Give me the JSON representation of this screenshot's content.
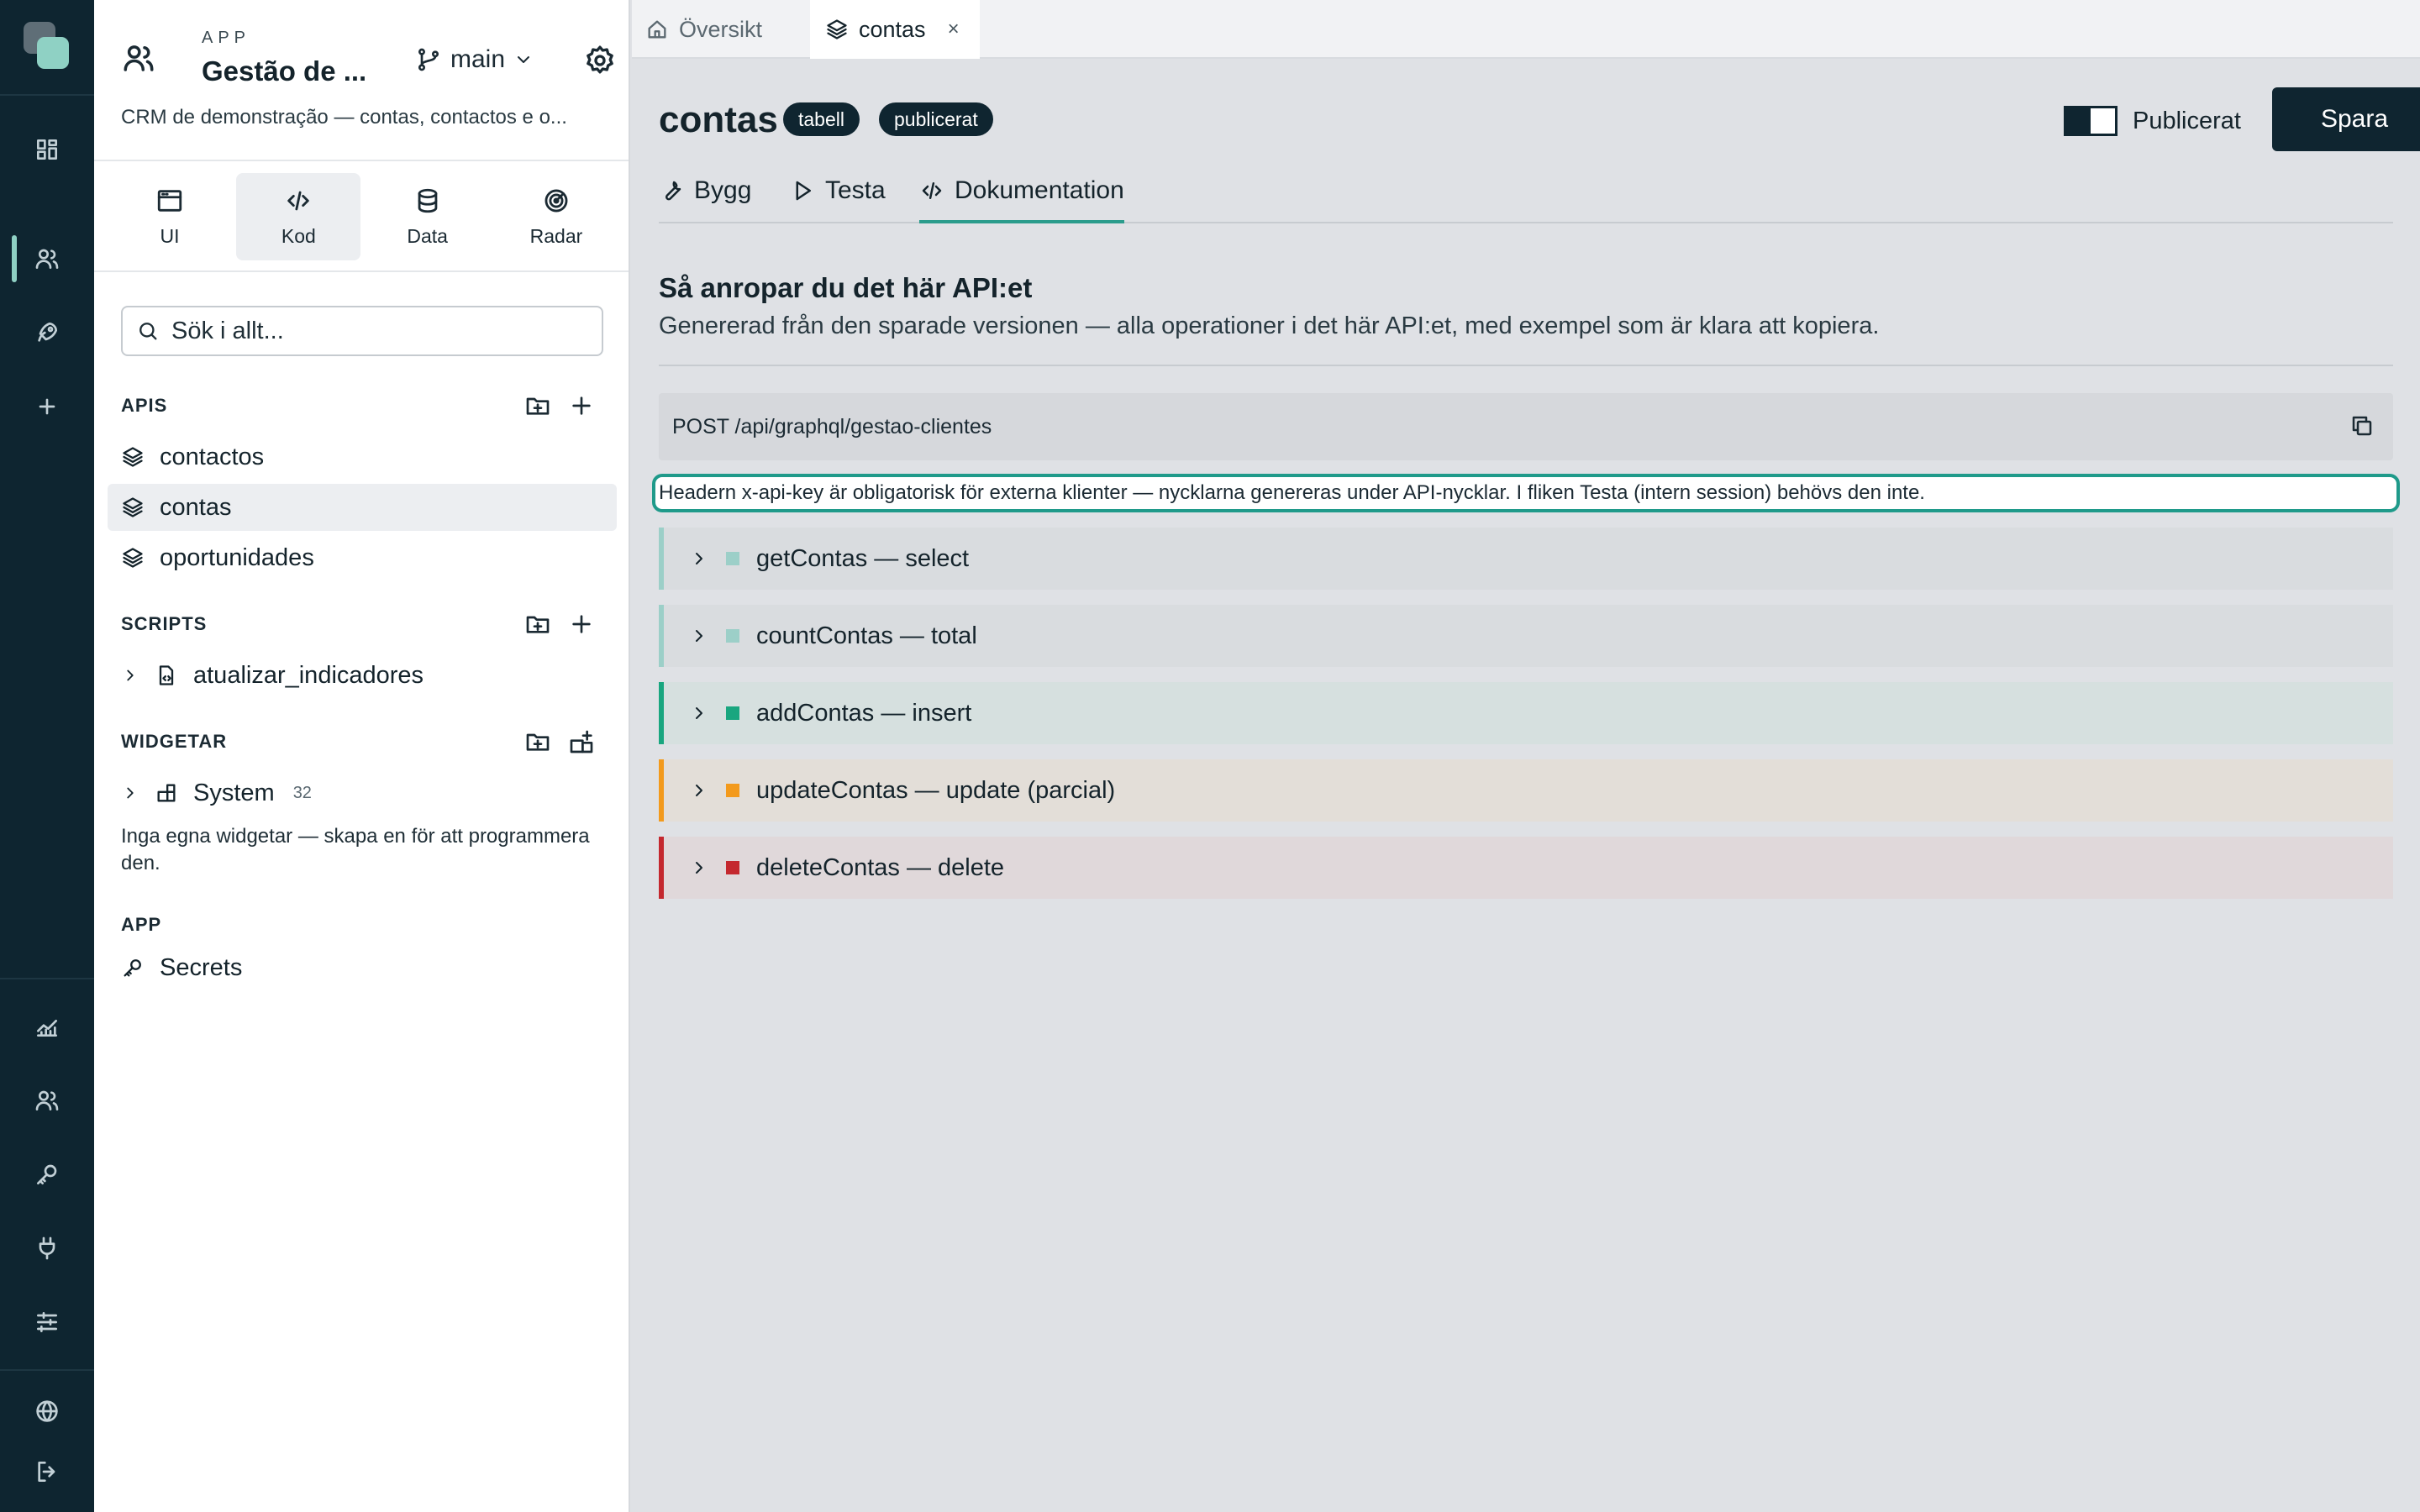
{
  "app": {
    "kicker": "APP",
    "title": "Gestão de ...",
    "branch": "main",
    "description": "CRM de demonstração — contas, contactos e o..."
  },
  "rail": {
    "icons": [
      "dashboard-icon",
      "users-icon",
      "rocket-icon",
      "plus-icon",
      "chart-icon",
      "team-icon",
      "key-icon",
      "plug-icon",
      "sliders-icon",
      "globe-icon",
      "logout-icon"
    ]
  },
  "modes": [
    {
      "label": "UI",
      "icon": "window-icon"
    },
    {
      "label": "Kod",
      "icon": "code-icon",
      "active": true
    },
    {
      "label": "Data",
      "icon": "database-icon"
    },
    {
      "label": "Radar",
      "icon": "radar-icon"
    }
  ],
  "search": {
    "placeholder": "Sök i allt..."
  },
  "sections": {
    "apis": {
      "title": "APIS",
      "items": [
        "contactos",
        "contas",
        "oportunidades"
      ],
      "active": "contas"
    },
    "scripts": {
      "title": "SCRIPTS",
      "items": [
        "atualizar_indicadores"
      ]
    },
    "widgets": {
      "title": "WIDGETAR",
      "system_label": "System",
      "system_count": "32",
      "empty": "Inga egna widgetar — skapa en för att programmera den."
    },
    "app": {
      "title": "APP",
      "items": [
        "Secrets"
      ]
    }
  },
  "tabs": [
    {
      "label": "Översikt",
      "icon": "home-icon"
    },
    {
      "label": "contas",
      "icon": "layers-icon",
      "active": true,
      "close": "×"
    }
  ],
  "page": {
    "title": "contas",
    "badges": [
      "tabell",
      "publicerat"
    ],
    "toggle_label": "Publicerat",
    "toggle_on": true,
    "save_label": "Spara",
    "subtabs": [
      {
        "label": "Bygg",
        "icon": "wrench-icon"
      },
      {
        "label": "Testa",
        "icon": "play-icon"
      },
      {
        "label": "Dokumentation",
        "icon": "code-icon",
        "active": true
      }
    ]
  },
  "docs": {
    "title": "Så anropar du det här API:et",
    "subtitle": "Genererad från den sparade versionen — alla operationer i det här API:et, med exempel som är klara att kopiera.",
    "endpoint": "POST /api/graphql/gestao-clientes",
    "hint": "Headern x-api-key är obligatorisk för externa klienter — nycklarna genereras under API-nycklar. I fliken Testa (intern session) behövs den inte.",
    "operations": [
      {
        "label": "getContas — select",
        "accent": "#9ccfc8",
        "square": "#9ccfc8",
        "bg": "#d9dcdf"
      },
      {
        "label": "countContas — total",
        "accent": "#9ccfc8",
        "square": "#9ccfc8",
        "bg": "#d9dcdf"
      },
      {
        "label": "addContas — insert",
        "accent": "#19a67f",
        "square": "#19a67f",
        "bg": "#d6e0df"
      },
      {
        "label": "updateContas — update (parcial)",
        "accent": "#f39a1c",
        "square": "#f39a1c",
        "bg": "#e3ded8"
      },
      {
        "label": "deleteContas — delete",
        "accent": "#c4282e",
        "square": "#c4282e",
        "bg": "#e0d8da"
      }
    ]
  }
}
